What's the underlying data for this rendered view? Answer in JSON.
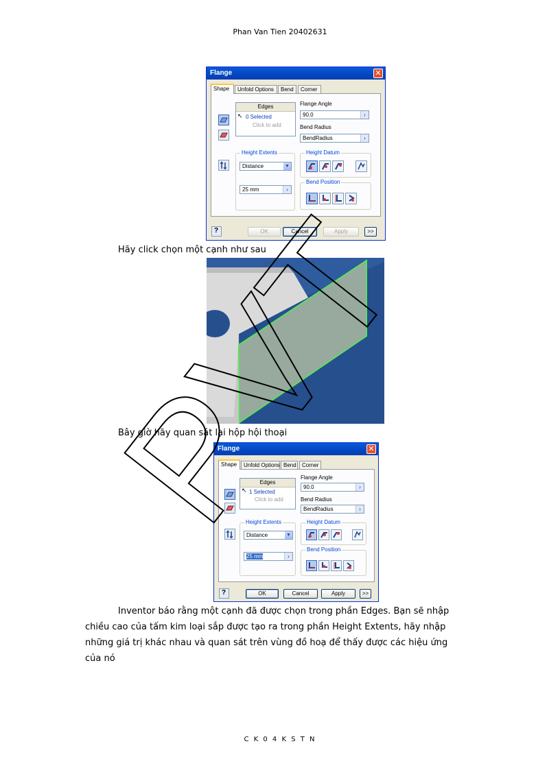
{
  "header": {
    "text": "Phan Van Tien 20402631"
  },
  "footer": {
    "text": "C K 0 4 K S T N"
  },
  "dialog_before": {
    "title": "Flange",
    "tabs": [
      "Shape",
      "Unfold Options",
      "Bend",
      "Corner"
    ],
    "edges_header": "Edges",
    "edges_selected": "0 Selected",
    "edges_click_to_add": "Click to add",
    "flange_angle_label": "Flange Angle",
    "flange_angle_value": "90.0",
    "bend_radius_label": "Bend Radius",
    "bend_radius_value": "BendRadius",
    "height_extents_label": "Height Extents",
    "height_extents_value": "Distance",
    "height_value": "25 mm",
    "height_datum_label": "Height Datum",
    "bend_position_label": "Bend Position",
    "buttons": {
      "ok": "OK",
      "cancel": "Cancel",
      "apply": "Apply",
      "more": ">>"
    }
  },
  "dialog_after": {
    "title": "Flange",
    "tabs": [
      "Shape",
      "Unfold Options",
      "Bend",
      "Corner"
    ],
    "edges_header": "Edges",
    "edges_selected": "1 Selected",
    "edges_click_to_add": "Click to add",
    "flange_angle_label": "Flange Angle",
    "flange_angle_value": "90.0",
    "bend_radius_label": "Bend Radius",
    "bend_radius_value": "BendRadius",
    "height_extents_label": "Height Extents",
    "height_extents_value": "Distance",
    "height_value": "25 mm",
    "height_datum_label": "Height Datum",
    "bend_position_label": "Bend Position",
    "buttons": {
      "ok": "OK",
      "cancel": "Cancel",
      "apply": "Apply",
      "more": ">>"
    }
  },
  "text": {
    "caption1": "Hãy click chọn một cạnh như sau",
    "caption2": "Bây giờ hãy quan sát lại hộp hội thoại",
    "para_lines": [
      "Inventor báo rằng một cạnh đã được chọn trong phần Edges. Bạn sẽ nhập",
      "chiều cao của tấm kim loại sắp được tạo ra trong phần Height Extents, hãy nhập",
      "những giá trị khác nhau và quan sát trên vùng đồ hoạ để thấy được các hiệu ứng",
      "của nó"
    ]
  },
  "watermark": "PVT",
  "colors": {
    "titlebar": "#0346c2",
    "dialog_bg": "#ece9d8",
    "scene_bg": "#264f8e",
    "edge_highlight": "#5de05d"
  }
}
